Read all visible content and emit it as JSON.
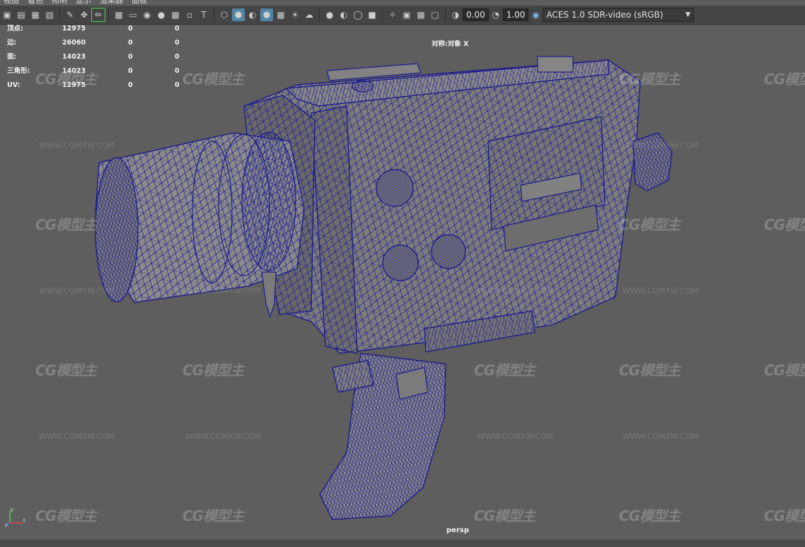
{
  "menu": [
    "视图",
    "着色",
    "照明",
    "显示",
    "渲染器",
    "面板"
  ],
  "toolbar": {
    "exposure": "0.00",
    "gamma": "1.00",
    "color_management": "ACES 1.0 SDR-video (sRGB)"
  },
  "hud": {
    "rows": [
      {
        "label": "顶点:",
        "v1": "12975",
        "v2": "0",
        "v3": "0"
      },
      {
        "label": "边:",
        "v1": "26060",
        "v2": "0",
        "v3": "0"
      },
      {
        "label": "面:",
        "v1": "14023",
        "v2": "0",
        "v3": "0"
      },
      {
        "label": "三角形:",
        "v1": "14023",
        "v2": "0",
        "v3": "0"
      },
      {
        "label": "UV:",
        "v1": "12975",
        "v2": "0",
        "v3": "0"
      }
    ],
    "symmetry": "对称:对象 X"
  },
  "camera": "persp",
  "axis": {
    "y": "y",
    "x": "x",
    "z": "z"
  },
  "watermark": {
    "logo": "CG模型主",
    "url": "WWW.CGMXW.COM"
  },
  "colors": {
    "wire": "#1c1c8c",
    "viewport_bg": "#5e5e5e"
  }
}
